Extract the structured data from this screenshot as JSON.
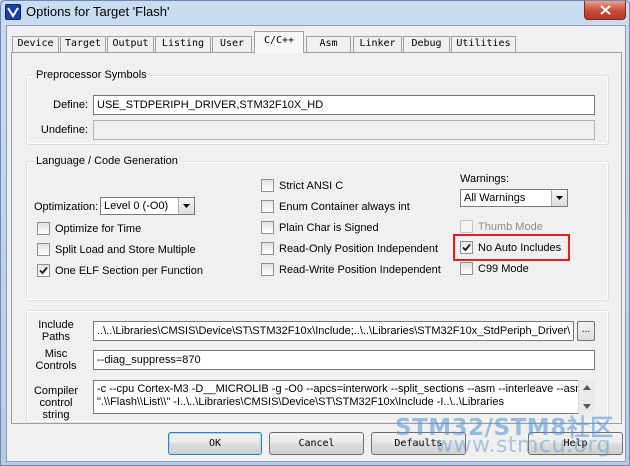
{
  "window": {
    "title": "Options for Target 'Flash'",
    "close_glyph": "✕"
  },
  "tabs": [
    {
      "label": "Device",
      "active": false
    },
    {
      "label": "Target",
      "active": false
    },
    {
      "label": "Output",
      "active": false
    },
    {
      "label": "Listing",
      "active": false
    },
    {
      "label": "User",
      "active": false
    },
    {
      "label": "C/C++",
      "active": true
    },
    {
      "label": "Asm",
      "active": false
    },
    {
      "label": "Linker",
      "active": false
    },
    {
      "label": "Debug",
      "active": false
    },
    {
      "label": "Utilities",
      "active": false
    }
  ],
  "preprocessor": {
    "title": "Preprocessor Symbols",
    "define_label": "Define:",
    "define_value": "USE_STDPERIPH_DRIVER,STM32F10X_HD",
    "undefine_label": "Undefine:",
    "undefine_value": ""
  },
  "language": {
    "title": "Language / Code Generation",
    "optimization_label": "Optimization:",
    "optimization_value": "Level 0 (-O0)",
    "optimize_for_time": {
      "label": "Optimize for Time",
      "checked": false
    },
    "split_load_store": {
      "label": "Split Load and Store Multiple",
      "checked": false
    },
    "one_elf_section": {
      "label": "One ELF Section per Function",
      "checked": true
    },
    "strict_ansi": {
      "label": "Strict ANSI C",
      "checked": false
    },
    "enum_container": {
      "label": "Enum Container always int",
      "checked": false
    },
    "plain_char_signed": {
      "label": "Plain Char is Signed",
      "checked": false
    },
    "ro_position_independent": {
      "label": "Read-Only Position Independent",
      "checked": false
    },
    "rw_position_independent": {
      "label": "Read-Write Position Independent",
      "checked": false
    },
    "warnings_label": "Warnings:",
    "warnings_value": "All Warnings",
    "thumb_mode": {
      "label": "Thumb Mode",
      "checked": false,
      "disabled": true
    },
    "no_auto_includes": {
      "label": "No Auto Includes",
      "checked": true,
      "highlighted": true
    },
    "c99_mode": {
      "label": "C99 Mode",
      "checked": false
    }
  },
  "paths": {
    "include_label_1": "Include",
    "include_label_2": "Paths",
    "include_value": "..\\..\\Libraries\\CMSIS\\Device\\ST\\STM32F10x\\Include;..\\..\\Libraries\\STM32F10x_StdPeriph_Driver\\",
    "browse_label": "...",
    "misc_label_1": "Misc",
    "misc_label_2": "Controls",
    "misc_value": "--diag_suppress=870",
    "compiler_label_1": "Compiler",
    "compiler_label_2": "control",
    "compiler_label_3": "string",
    "compiler_line_1": "-c --cpu Cortex-M3 -D__MICROLIB -g -O0 --apcs=interwork --split_sections --asm --interleave --asm_dir",
    "compiler_line_2": "\".\\\\Flash\\\\List\\\\\" -I..\\..\\Libraries\\CMSIS\\Device\\ST\\STM32F10x\\Include -I..\\..\\Libraries"
  },
  "buttons": {
    "ok": "OK",
    "cancel": "Cancel",
    "defaults": "Defaults",
    "help": "Help"
  },
  "watermark": {
    "line1": "STM32/STM8社区",
    "line2": "www.stmcu.org"
  },
  "colors": {
    "highlight_box": "#e02020",
    "watermark": "#5091cd"
  }
}
